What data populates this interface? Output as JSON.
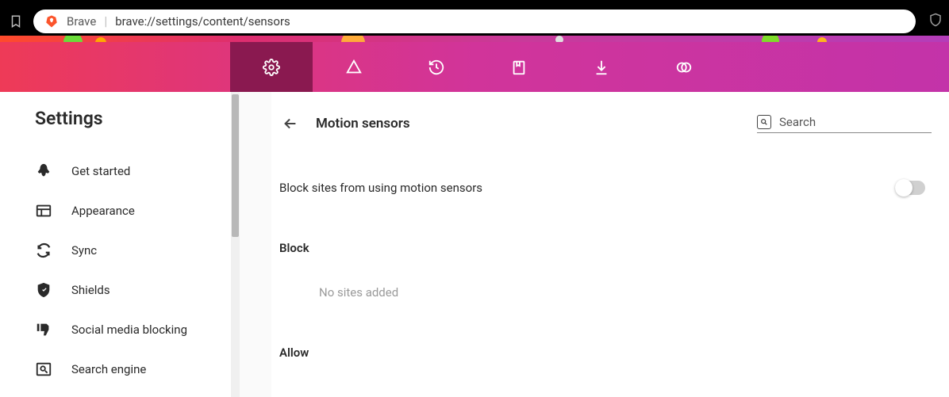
{
  "url_bar": {
    "label": "Brave",
    "url": "brave://settings/content/sensors"
  },
  "sidebar": {
    "title": "Settings",
    "items": [
      {
        "label": "Get started"
      },
      {
        "label": "Appearance"
      },
      {
        "label": "Sync"
      },
      {
        "label": "Shields"
      },
      {
        "label": "Social media blocking"
      },
      {
        "label": "Search engine"
      }
    ]
  },
  "main": {
    "title": "Motion sensors",
    "search_placeholder": "Search",
    "toggle_label": "Block sites from using motion sensors",
    "block_section": "Block",
    "block_empty": "No sites added",
    "allow_section": "Allow"
  }
}
